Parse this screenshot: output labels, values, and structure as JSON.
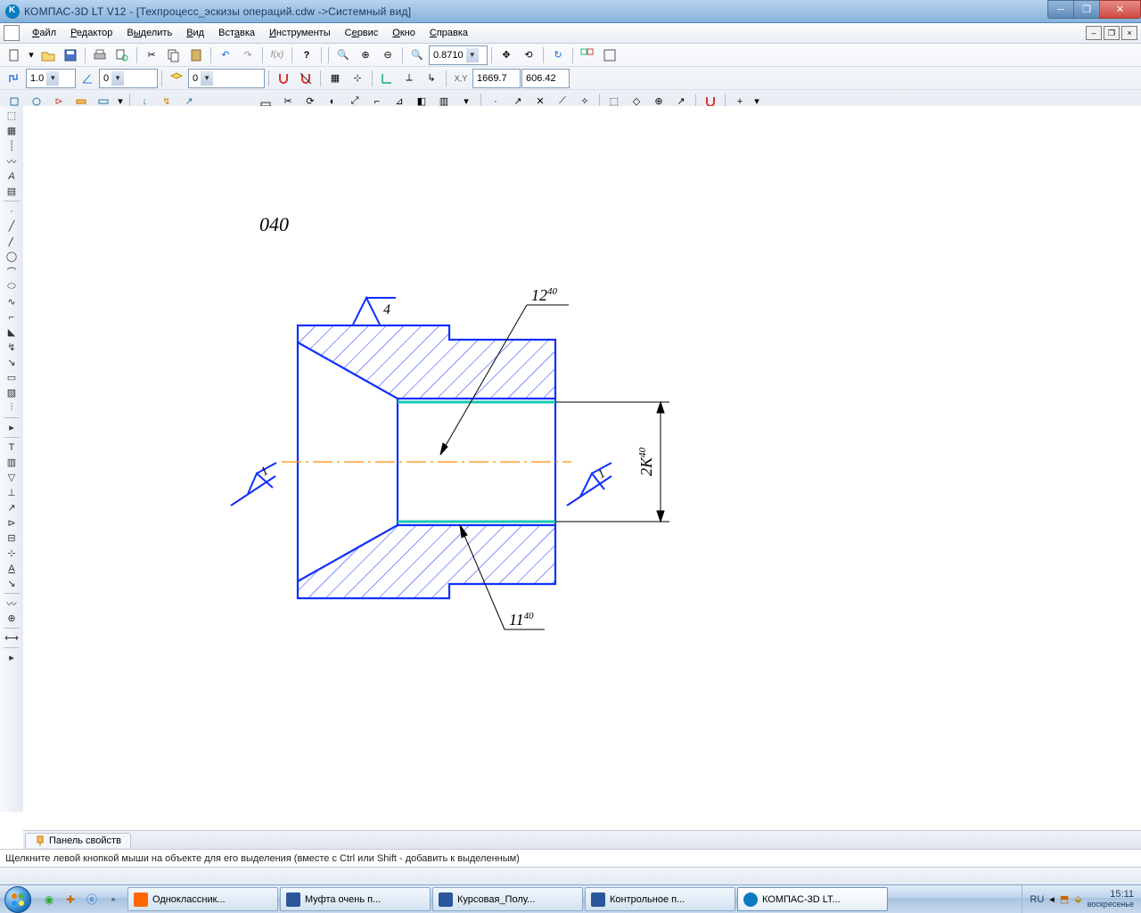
{
  "title": "КОМПАС-3D LT V12 - [Техпроцесс_эскизы операций.cdw ->Системный вид]",
  "menu": {
    "file": "Файл",
    "editor": "Редактор",
    "select": "Выделить",
    "view": "Вид",
    "insert": "Вставка",
    "tools": "Инструменты",
    "service": "Сервис",
    "window": "Окно",
    "help": "Справка"
  },
  "toolbar": {
    "zoom_value": "0.8710",
    "line_width": "1.0",
    "style_num": "0",
    "layer_num": "0",
    "coord_x": "1669.7",
    "coord_y": "606.42"
  },
  "panel": {
    "properties_tab": "Панель свойств"
  },
  "drawing": {
    "op_number": "040",
    "dim_top": "12",
    "dim_top_sup": "40",
    "dim_right_main": "2К",
    "dim_right_sup": "40",
    "dim_bottom": "11",
    "dim_bottom_sup": "40",
    "rough_top": "4",
    "rough_bl": "1",
    "rough_br": "1"
  },
  "hint": "Щелкните левой кнопкой мыши на объекте для его выделения (вместе с Ctrl или Shift - добавить к выделенным)",
  "taskbar": {
    "items": [
      {
        "label": "Одноклассник..."
      },
      {
        "label": "Муфта очень п..."
      },
      {
        "label": "Курсовая_Полу..."
      },
      {
        "label": "Контрольное п..."
      },
      {
        "label": "КОМПАС-3D LT..."
      }
    ],
    "lang": "RU",
    "time": "15:11",
    "day": "воскресенье"
  }
}
